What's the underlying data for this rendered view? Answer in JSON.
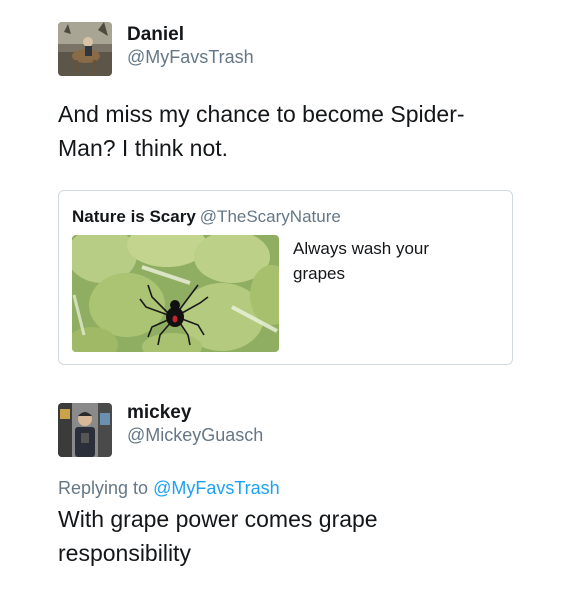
{
  "tweet": {
    "author_name": "Daniel",
    "author_handle": "@MyFavsTrash",
    "text": "And miss my chance to become Spider-\nMan? I think not.",
    "quoted": {
      "author_name": "Nature is Scary",
      "author_handle": "@TheScaryNature",
      "text": "Always wash your grapes"
    }
  },
  "reply": {
    "author_name": "mickey",
    "author_handle": "@MickeyGuasch",
    "replying_to_prefix": "Replying to",
    "replying_to_handle": "@MyFavsTrash",
    "text": "With grape power comes grape\nresponsibility"
  },
  "colors": {
    "link": "#1da1f2",
    "secondary_text": "#657786",
    "border": "#cfd9de"
  }
}
